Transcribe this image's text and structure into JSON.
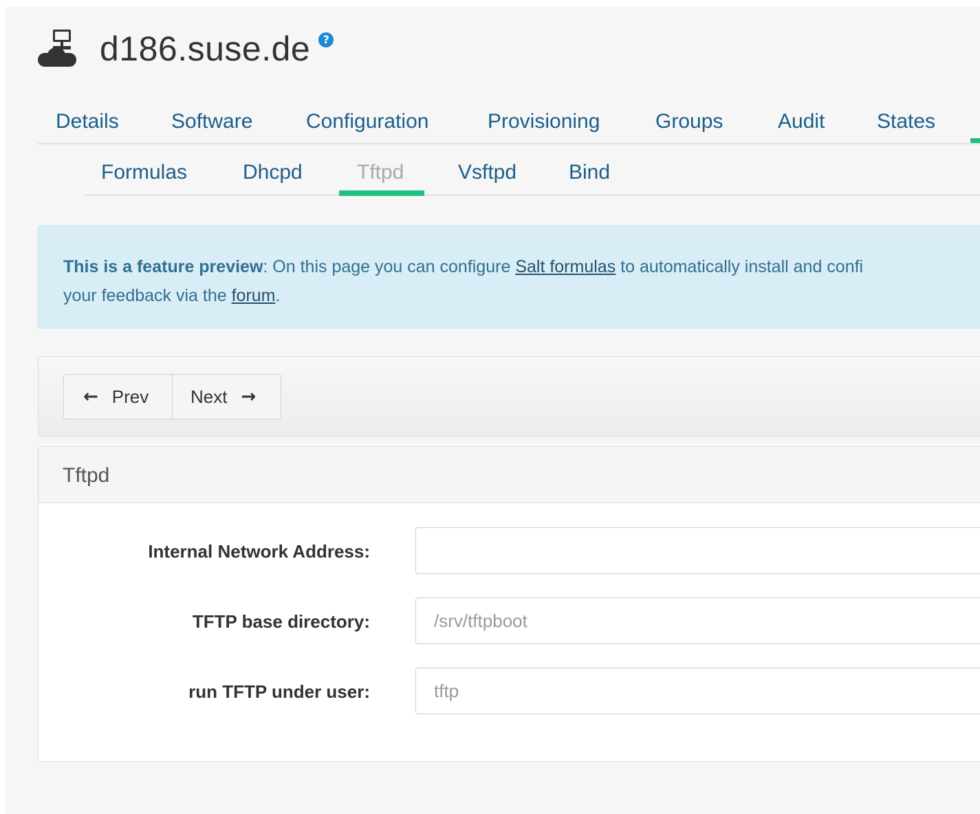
{
  "header": {
    "title": "d186.suse.de",
    "server_icon": "server-cloud-icon",
    "help_icon": "question-circle-icon",
    "help_glyph": "?"
  },
  "tabs": [
    {
      "label": "Details"
    },
    {
      "label": "Software"
    },
    {
      "label": "Configuration"
    },
    {
      "label": "Provisioning"
    },
    {
      "label": "Groups"
    },
    {
      "label": "Audit"
    },
    {
      "label": "States"
    }
  ],
  "subtabs": [
    {
      "label": "Formulas"
    },
    {
      "label": "Dhcpd"
    },
    {
      "label": "Tftpd",
      "active": true
    },
    {
      "label": "Vsftpd"
    },
    {
      "label": "Bind"
    }
  ],
  "alert": {
    "strong": "This is a feature preview",
    "text1": ": On this page you can configure ",
    "link1": "Salt formulas",
    "text2": " to automatically install and confi",
    "text3": "your feedback via the ",
    "link2": "forum",
    "text4": "."
  },
  "buttons": {
    "prev": "Prev",
    "next": "Next",
    "prev_icon": "arrow-left-icon",
    "next_icon": "arrow-right-icon"
  },
  "panel": {
    "title": "Tftpd",
    "fields": [
      {
        "label": "Internal Network Address:",
        "value": "",
        "placeholder": ""
      },
      {
        "label": "TFTP base directory:",
        "value": "",
        "placeholder": "/srv/tftpboot"
      },
      {
        "label": "run TFTP under user:",
        "value": "",
        "placeholder": "tftp"
      }
    ]
  },
  "colors": {
    "accent": "#1ec17f",
    "link": "#1b5e8a",
    "alert_bg": "#d9edf7",
    "alert_text": "#31708f",
    "help": "#1e88d8"
  }
}
